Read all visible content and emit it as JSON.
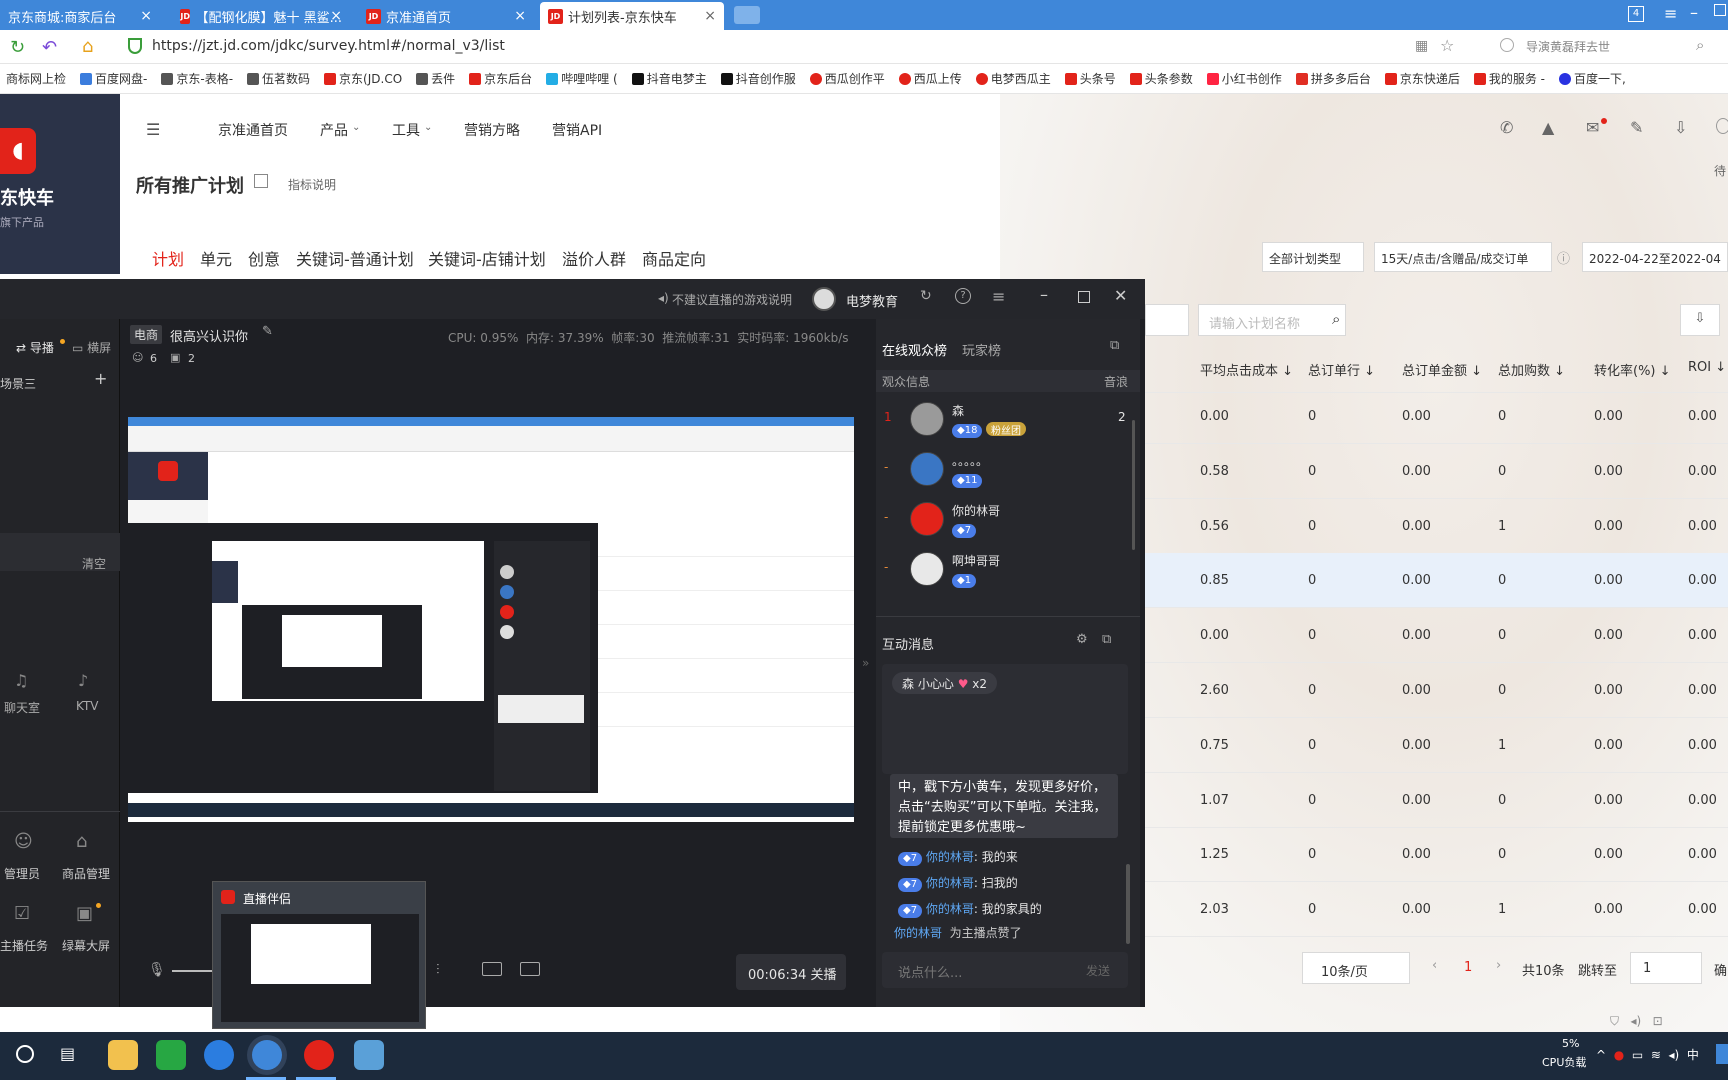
{
  "tabs": [
    {
      "title": "京东商城:商家后台"
    },
    {
      "title": "【配钢化膜】魅十 黑鲨..."
    },
    {
      "title": "京准通首页"
    },
    {
      "title": "计划列表-京东快车"
    }
  ],
  "address": {
    "url": "https://jzt.jd.com/jdkc/survey.html#/normal_v3/list",
    "search_placeholder": "导演黄磊拜去世"
  },
  "bookmarks": [
    "商标网上检",
    "百度网盘-",
    "京东-表格-",
    "伍茗数码",
    "京东(JD.CO",
    "丢件",
    "京东后台",
    "哔哩哔哩 (",
    "抖音电梦主",
    "抖音创作服",
    "西瓜创作平",
    "西瓜上传",
    "电梦西瓜主",
    "头条号",
    "头条参数",
    "小红书创作",
    "拼多多后台",
    "京东快递后",
    "我的服务 -",
    "百度一下,"
  ],
  "brand": {
    "name": "东快车",
    "sub": "旗下产品"
  },
  "topnav": {
    "items": [
      "京准通首页",
      "产品",
      "工具",
      "营销方略",
      "营销API"
    ]
  },
  "page": {
    "title": "所有推广计划",
    "explain": "指标说明",
    "side_right": "待"
  },
  "plan_tabs": [
    "计划",
    "单元",
    "创意",
    "关键词-普通计划",
    "关键词-店铺计划",
    "溢价人群",
    "商品定向"
  ],
  "filters": {
    "plan_type": "全部计划类型",
    "attribution": "15天/点击/含赠品/成交订单",
    "date": "2022-04-22至2022-04",
    "search_placeholder": "请输入计划名称"
  },
  "table": {
    "headers": [
      "平均点击成本 ↓",
      "总订单行 ↓",
      "总订单金额 ↓",
      "总加购数 ↓",
      "转化率(%) ↓",
      "ROI ↓"
    ],
    "rows": [
      [
        "0.00",
        "0",
        "0.00",
        "0",
        "0.00",
        "0.00"
      ],
      [
        "0.58",
        "0",
        "0.00",
        "0",
        "0.00",
        "0.00"
      ],
      [
        "0.56",
        "0",
        "0.00",
        "1",
        "0.00",
        "0.00"
      ],
      [
        "0.85",
        "0",
        "0.00",
        "0",
        "0.00",
        "0.00"
      ],
      [
        "0.00",
        "0",
        "0.00",
        "0",
        "0.00",
        "0.00"
      ],
      [
        "2.60",
        "0",
        "0.00",
        "0",
        "0.00",
        "0.00"
      ],
      [
        "0.75",
        "0",
        "0.00",
        "1",
        "0.00",
        "0.00"
      ],
      [
        "1.07",
        "0",
        "0.00",
        "0",
        "0.00",
        "0.00"
      ],
      [
        "1.25",
        "0",
        "0.00",
        "0",
        "0.00",
        "0.00"
      ],
      [
        "2.03",
        "0",
        "0.00",
        "1",
        "0.00",
        "0.00"
      ]
    ]
  },
  "pagination": {
    "page_size": "10条/页",
    "current": "1",
    "total": "共10条",
    "jump_label": "跳转至",
    "jump_value": "1",
    "confirm": "确"
  },
  "live": {
    "notice": "不建议直播的游戏说明",
    "username": "电梦教育",
    "left_tabs": [
      "导播",
      "横屏"
    ],
    "scene": "场景三",
    "clear": "清空",
    "tools": [
      "聊天室",
      "KTV",
      "管理员",
      "商品管理",
      "主播任务",
      "绿幕大屏"
    ],
    "category": "电商",
    "room_title": "很高兴认识你",
    "viewers_count": "6",
    "gifts_count": "2",
    "stats": {
      "cpu": "CPU: 0.95%",
      "mem": "内存: 37.39%",
      "fps": "帧率:30",
      "push_fps": "推流帧率:31",
      "bitrate": "实时码率: 1960kb/s"
    },
    "timer": "00:06:34 关播",
    "thumb_title": "直播伴侣"
  },
  "audience": {
    "tabs": [
      "在线观众榜",
      "玩家榜"
    ],
    "info_label": "观众信息",
    "sound_label": "音浪",
    "viewers": [
      {
        "rank": "1",
        "name": "森",
        "level": "18",
        "fan_badge": "粉丝团",
        "score": "2"
      },
      {
        "rank": "-",
        "name": "。。。。。",
        "level": "11",
        "score": ""
      },
      {
        "rank": "-",
        "name": "你的林哥",
        "level": "7",
        "score": ""
      },
      {
        "rank": "-",
        "name": "啊坤哥哥",
        "level": "1",
        "score": ""
      }
    ]
  },
  "chat": {
    "title": "互动消息",
    "gift": {
      "user": "森",
      "gift_name": "小心心",
      "count": "x2"
    },
    "system": "中，戳下方小黄车，发现更多好价，点击“去购买”可以下单啦。关注我，提前锁定更多优惠哦~",
    "messages": [
      {
        "level": "7",
        "user": "你的林哥",
        "text": "我的来"
      },
      {
        "level": "7",
        "user": "你的林哥",
        "text": "扫我的"
      },
      {
        "level": "7",
        "user": "你的林哥",
        "text": "我的家具的"
      }
    ],
    "like_user": "你的林哥",
    "like_text": "为主播点赞了",
    "input_placeholder": "说点什么...",
    "send": "发送"
  },
  "taskbar": {
    "cpu_pct": "5%",
    "cpu_label": "CPU负载",
    "ime": "中"
  }
}
